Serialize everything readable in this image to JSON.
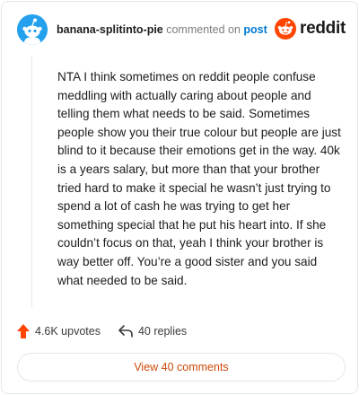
{
  "header": {
    "username": "banana-splitinto-pie",
    "verb": "commented on",
    "post_link": "post",
    "logo_text": "reddit"
  },
  "comment": {
    "body": "NTA I think sometimes on reddit people confuse meddling with actually caring about people and telling them what needs to be said. Sometimes people show you their true colour but people are just blind to it because their emotions get in the way. 40k is a years salary, but more than that your brother tried hard to make it special he wasn’t just trying to spend a lot of cash he was trying to get her something special that he put his heart into. If she couldn’t focus on that, yeah I think your brother is way better off. You’re a good sister and you said what needed to be said."
  },
  "actions": {
    "upvotes": "4.6K upvotes",
    "replies": "40 replies",
    "view_comments": "View 40 comments"
  },
  "icons": {
    "avatar": "snoo-avatar-icon",
    "logo": "reddit-logo-icon",
    "upvote": "upvote-arrow-icon",
    "reply": "reply-arrow-icon"
  },
  "colors": {
    "brand": "#ff4500",
    "link": "#0079d3",
    "avatar_bg": "#24a0ed",
    "button_text": "#cf4a0a"
  }
}
